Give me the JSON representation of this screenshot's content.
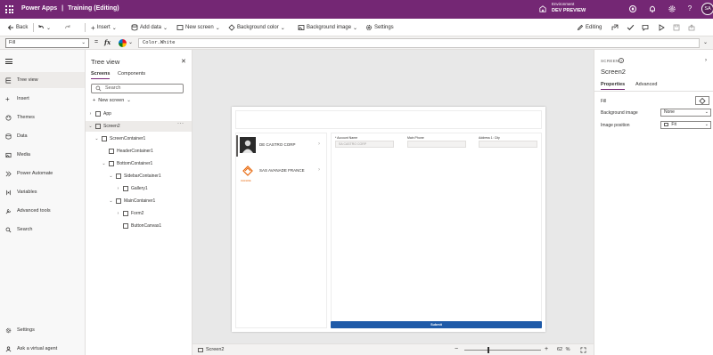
{
  "titlebar": {
    "app_name": "Power Apps",
    "separator": "|",
    "app_status": "Training (Editing)",
    "environment_label": "Environment",
    "environment_name": "DEV PREVIEW",
    "avatar_initials": "SA",
    "help_glyph": "?"
  },
  "cmdbar": {
    "back": "Back",
    "insert": "Insert",
    "add_data": "Add data",
    "new_screen": "New screen",
    "background_color": "Background color",
    "background_image": "Background image",
    "settings": "Settings",
    "editing": "Editing"
  },
  "formula": {
    "property": "Fill",
    "eq": "=",
    "fx": "fx",
    "value": "Color.White"
  },
  "leftnav": {
    "items": [
      {
        "label": "Tree view",
        "icon": "tree-view-icon"
      },
      {
        "label": "Insert",
        "icon": "plus-icon"
      },
      {
        "label": "Themes",
        "icon": "palette-icon"
      },
      {
        "label": "Data",
        "icon": "database-icon"
      },
      {
        "label": "Media",
        "icon": "media-icon"
      },
      {
        "label": "Power Automate",
        "icon": "power-automate-icon"
      },
      {
        "label": "Variables",
        "icon": "variables-icon"
      },
      {
        "label": "Advanced tools",
        "icon": "tools-icon"
      },
      {
        "label": "Search",
        "icon": "search-icon"
      }
    ],
    "settings": "Settings",
    "virtual_agent": "Ask a virtual agent"
  },
  "tree": {
    "title": "Tree view",
    "tabs": [
      "Screens",
      "Components"
    ],
    "search_placeholder": "Search",
    "new_screen": "New screen",
    "nodes": {
      "app": "App",
      "screen2": "Screen2",
      "screen_container": "ScreenContainer1",
      "header_container": "HeaderContainer1",
      "bottom_container": "BottomContainer1",
      "sidebar_container": "SidebarContainer1",
      "gallery": "Gallery1",
      "main_container": "MainContainer1",
      "form": "Form2",
      "button_canvas": "ButtonCanvas1"
    },
    "more_glyph": "···"
  },
  "app_screen": {
    "gallery": [
      {
        "name": "DE CASTRO CORP",
        "selected": true
      },
      {
        "name": "SAS AVANADE FRANCE",
        "selected": false
      }
    ],
    "form_fields": [
      {
        "label": "* Account Name",
        "value": "SA CASTRO CORP"
      },
      {
        "label": "Main Phone",
        "value": ""
      },
      {
        "label": "Address 1: City",
        "value": ""
      }
    ],
    "submit_label": "Submit",
    "logo_caption": "AVANADE"
  },
  "statusbar": {
    "screen_name": "Screen2",
    "zoom_minus": "−",
    "zoom_plus": "+",
    "zoom_value": "62",
    "zoom_unit": "%",
    "zoom_fraction": 0.62
  },
  "props": {
    "kind": "SCREEN",
    "name": "Screen2",
    "tabs": [
      "Properties",
      "Advanced"
    ],
    "fill_label": "Fill",
    "background_image_label": "Background image",
    "background_image_value": "None",
    "image_position_label": "Image position",
    "image_position_value": "Fit"
  },
  "colors": {
    "brand": "#742774",
    "submit": "#1e5aa8"
  }
}
